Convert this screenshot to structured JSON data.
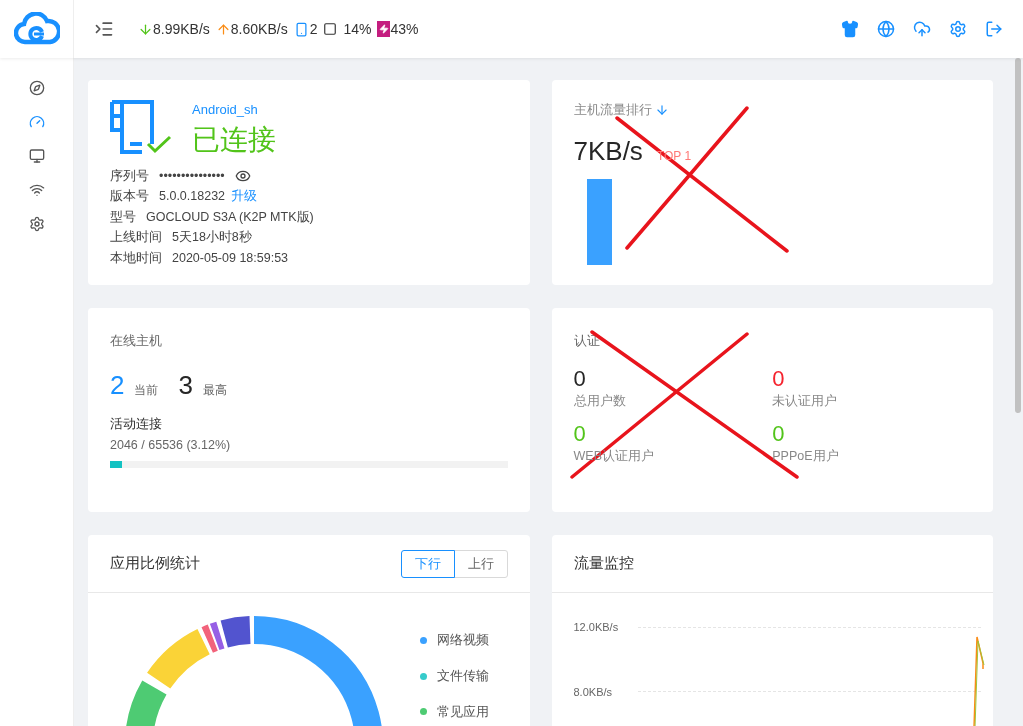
{
  "header": {
    "download": "8.99KB/s",
    "upload": "8.60KB/s",
    "devices": "2",
    "cpu": "14%",
    "battery": "43%"
  },
  "sidebar": {
    "items": [
      {
        "kind": "compass",
        "selected": false
      },
      {
        "kind": "dashboard",
        "selected": true
      },
      {
        "kind": "monitor",
        "selected": false
      },
      {
        "kind": "wifi",
        "selected": false
      },
      {
        "kind": "settings",
        "selected": false
      }
    ]
  },
  "router_card": {
    "name": "Android_sh",
    "status": "已连接",
    "rows": [
      {
        "kind": "serial",
        "label": "序列号",
        "value": "•••••••••••••••"
      },
      {
        "kind": "version",
        "label": "版本号",
        "value": "5.0.0.18232",
        "link": "升级"
      },
      {
        "kind": "plain",
        "label": "型号",
        "value": "GOCLOUD S3A (K2P MTK版)"
      },
      {
        "kind": "plain",
        "label": "上线时间",
        "value": "5天18小时8秒"
      },
      {
        "kind": "plain",
        "label": "本地时间",
        "value": "2020-05-09 18:59:53"
      }
    ]
  },
  "host_traffic": {
    "title": "主机流量排行",
    "speed": "7KB/s",
    "rank": "TOP 1"
  },
  "online_hosts": {
    "title": "在线主机",
    "current": "2",
    "current_label": "当前",
    "max": "3",
    "max_label": "最高",
    "connections_title": "活动连接",
    "connections": "2046 / 65536 (3.12%)",
    "level": 0.0312
  },
  "auth": {
    "title": "认证",
    "stats": [
      {
        "value": "0",
        "label": "总用户数",
        "color": "#262626"
      },
      {
        "value": "0",
        "label": "未认证用户",
        "color": "#f5222d"
      },
      {
        "value": "0",
        "label": "WEB认证用户",
        "color": "#52c41a"
      },
      {
        "value": "0",
        "label": "PPPoE用户",
        "color": "#52c41a"
      }
    ]
  },
  "app_ratio": {
    "title": "应用比例统计",
    "tabs": [
      {
        "label": "下行",
        "selected": true
      },
      {
        "label": "上行",
        "selected": false
      }
    ],
    "legend": [
      {
        "label": "网络视频",
        "color": "#3aa1ff"
      },
      {
        "label": "文件传输",
        "color": "#36cbcb"
      },
      {
        "label": "常见应用",
        "color": "#4ecb73"
      }
    ]
  },
  "traffic_monitor": {
    "title": "流量监控",
    "y_labels": [
      "12.0KB/s",
      "8.0KB/s"
    ]
  }
}
